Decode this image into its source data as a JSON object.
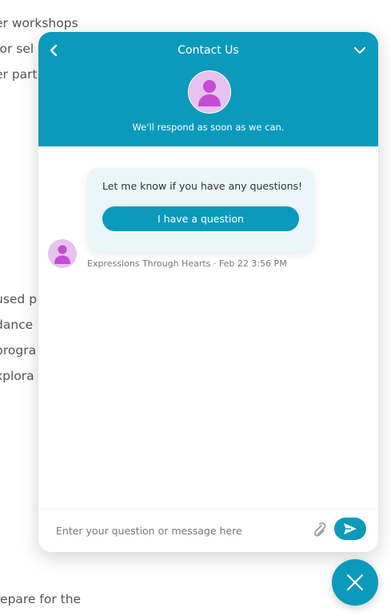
{
  "background_page": {
    "lines": [
      "er workshops",
      "for sel",
      "er part",
      "used p",
      "dance",
      "progra",
      "xplora",
      "repare for the"
    ]
  },
  "chat": {
    "header": {
      "title": "Contact Us",
      "subtitle": "We'll respond as soon as we can.",
      "back_icon": "chevron-left-icon",
      "collapse_icon": "chevron-down-icon"
    },
    "messages": [
      {
        "text": "Let me know if you have any questions!",
        "quick_reply": "I have a question",
        "meta": "Expressions Through Hearts · Feb 22 3:56 PM"
      }
    ],
    "composer": {
      "placeholder": "Enter your question or message here",
      "value": "",
      "attach_icon": "paperclip-icon",
      "send_icon": "send-icon"
    }
  },
  "launcher": {
    "icon": "close-icon"
  },
  "colors": {
    "accent": "#0b9abb",
    "avatar_bg": "#e7c2ee",
    "avatar_figure": "#c34bd6",
    "bubble_bg": "#eaf6f9"
  }
}
